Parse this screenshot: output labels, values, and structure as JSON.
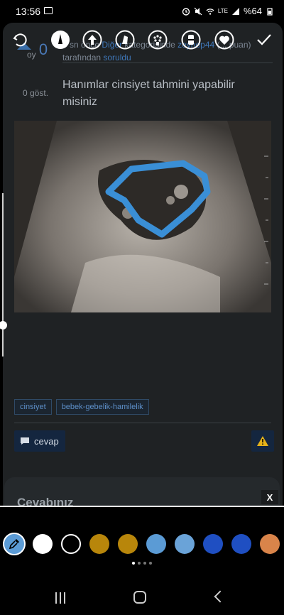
{
  "status": {
    "time": "13:56",
    "battery": "%64",
    "network": "LTE"
  },
  "question": {
    "votes": "0",
    "votes_label": "oy",
    "views": "0 göst.",
    "meta_prefix": "5 sn önce",
    "meta_category_label": "Diğer",
    "meta_category_text": " kategorisinde ",
    "meta_user": "zeynep44",
    "meta_points": " (... puan)",
    "meta_by": "tarafından ",
    "meta_asked": "soruldu",
    "title": "Hanımlar cinsiyet tahmini yapabilir misiniz",
    "tags": [
      "cinsiyet",
      "bebek-gebelik-hamilelik"
    ],
    "reply_label": "cevap"
  },
  "answer_section": {
    "title": "Cevabınız"
  },
  "editor": {
    "tools": [
      "undo-icon",
      "pen-icon",
      "arrow-up-icon",
      "highlighter-icon",
      "dots-brush-icon",
      "marker-icon",
      "heart-brush-icon",
      "done-icon"
    ],
    "palette": [
      "#ffffff",
      "#000000",
      "#b8860b",
      "#b8860b",
      "#5b9bd5",
      "#6aa3d8",
      "#1f4fc2",
      "#1f4fc2",
      "#d9844a"
    ],
    "selected_color": "#5b9bd5",
    "page_count": 4,
    "active_page": 1
  },
  "close_label": "X"
}
